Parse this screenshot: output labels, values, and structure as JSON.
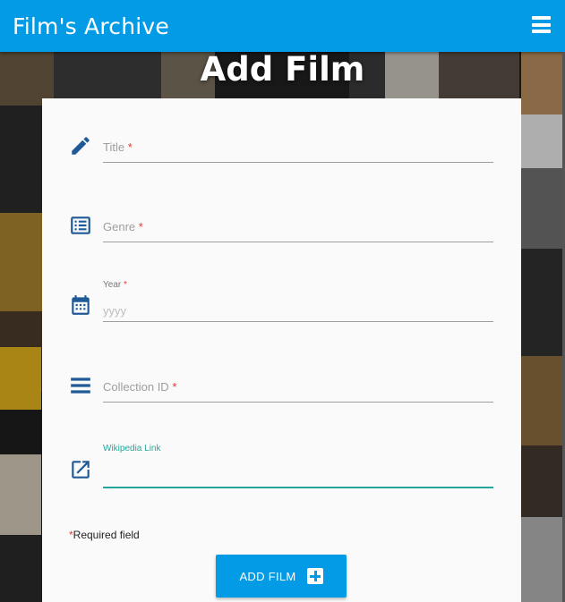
{
  "app": {
    "brand": "Film's Archive",
    "menu_icon": "hamburger-menu-icon"
  },
  "page": {
    "title": "Add Film"
  },
  "form": {
    "fields": [
      {
        "icon": "pencil-icon",
        "label": "Title",
        "required": "*",
        "value": "",
        "placeholder": ""
      },
      {
        "icon": "list-icon",
        "label": "Genre",
        "required": "*",
        "value": "",
        "placeholder": ""
      },
      {
        "icon": "calendar-icon",
        "label": "Year",
        "required": "*",
        "value": "",
        "placeholder": "yyyy"
      },
      {
        "icon": "lines-icon",
        "label": "Collection ID",
        "required": "*",
        "value": "",
        "placeholder": ""
      },
      {
        "icon": "external-link-icon",
        "label": "Wikipedia Link",
        "required": "",
        "value": "",
        "placeholder": ""
      }
    ],
    "required_note": {
      "asterisk": "*",
      "text": "Required field"
    },
    "submit": {
      "label": "ADD FILM",
      "icon": "plus-box-icon"
    }
  },
  "colors": {
    "appbar": "#039be5",
    "icon": "#1f5a96",
    "focus": "#26a69a",
    "required": "#e53935"
  }
}
